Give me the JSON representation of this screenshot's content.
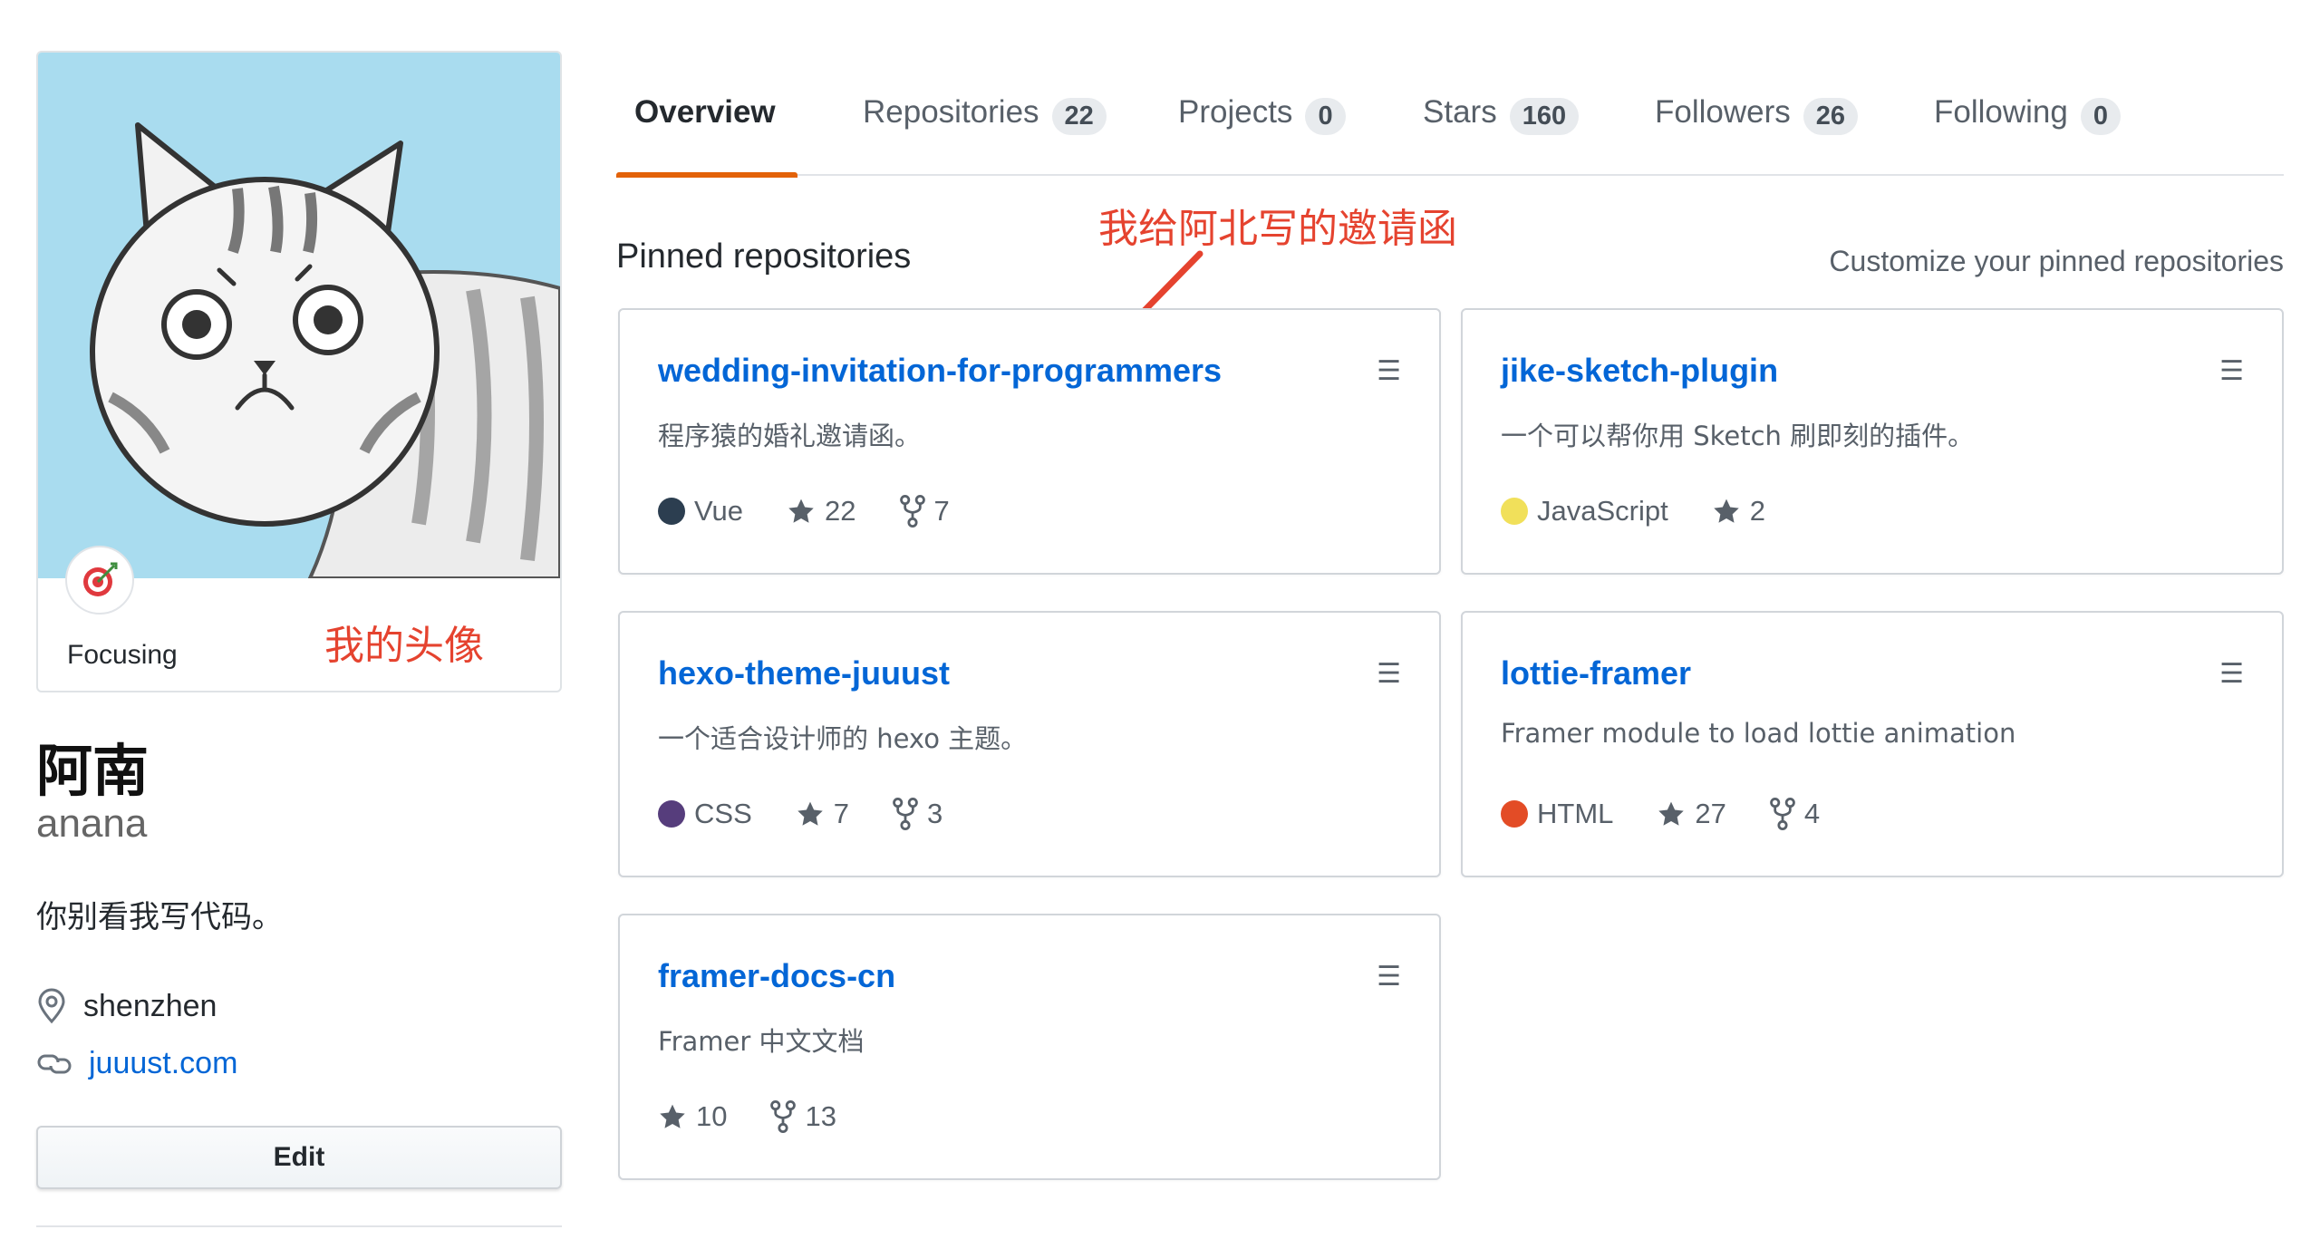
{
  "profile": {
    "status_text": "Focusing",
    "avatar_annotation": "我的头像",
    "name": "阿南",
    "username": "anana",
    "bio": "你别看我写代码。",
    "location": "shenzhen",
    "website": "juuust.com",
    "edit_label": "Edit"
  },
  "tabs": [
    {
      "label": "Overview",
      "count": null
    },
    {
      "label": "Repositories",
      "count": "22"
    },
    {
      "label": "Projects",
      "count": "0"
    },
    {
      "label": "Stars",
      "count": "160"
    },
    {
      "label": "Followers",
      "count": "26"
    },
    {
      "label": "Following",
      "count": "0"
    }
  ],
  "pinned": {
    "title": "Pinned repositories",
    "customize_label": "Customize your pinned repositories",
    "annotation": "我给阿北写的邀请函",
    "repos": [
      {
        "name": "wedding-invitation-for-programmers",
        "description": "程序猿的婚礼邀请函。",
        "language": "Vue",
        "language_color": "#2c3e50",
        "stars": "22",
        "forks": "7"
      },
      {
        "name": "jike-sketch-plugin",
        "description": "一个可以帮你用 Sketch 刷即刻的插件。",
        "language": "JavaScript",
        "language_color": "#f1e05a",
        "stars": "2",
        "forks": null
      },
      {
        "name": "hexo-theme-juuust",
        "description": "一个适合设计师的 hexo 主题。",
        "language": "CSS",
        "language_color": "#563d7c",
        "stars": "7",
        "forks": "3"
      },
      {
        "name": "lottie-framer",
        "description": "Framer module to load lottie animation",
        "language": "HTML",
        "language_color": "#e34c26",
        "stars": "27",
        "forks": "4"
      },
      {
        "name": "framer-docs-cn",
        "description": "Framer 中文文档",
        "language": null,
        "language_color": null,
        "stars": "10",
        "forks": "13"
      }
    ]
  },
  "colors": {
    "link": "#0366d6",
    "annotation": "#e5432f",
    "tab_active_underline": "#e36209",
    "avatar_background": "#a9dcef"
  },
  "icons": [
    "target-emoji-icon",
    "location-pin-icon",
    "link-icon",
    "star-icon",
    "fork-icon",
    "menu-icon",
    "arrow-icon"
  ]
}
